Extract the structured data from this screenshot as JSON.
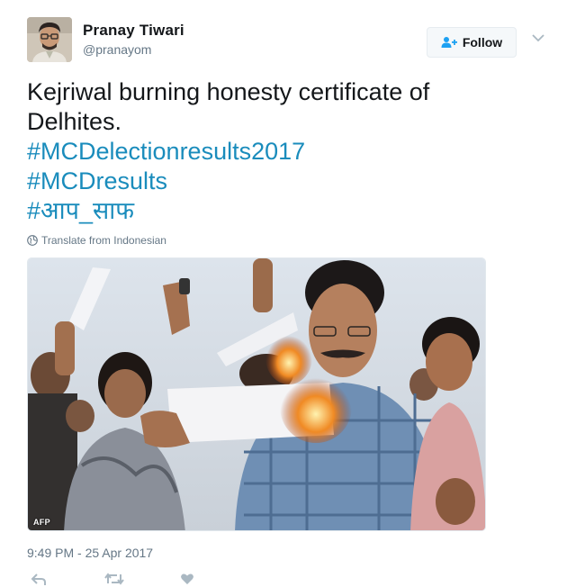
{
  "author": {
    "display_name": "Pranay Tiwari",
    "handle": "@pranayom",
    "avatar_icon": "profile-photo"
  },
  "follow": {
    "label": "Follow",
    "icon": "add-user-icon"
  },
  "menu": {
    "icon": "chevron-down-icon"
  },
  "tweet": {
    "text_lines": [
      "Kejriwal burning honesty certificate of",
      "Delhites."
    ],
    "hashtags": [
      "#MCDelectionresults2017",
      "#MCDresults",
      "#आप_साफ"
    ],
    "translate_label": "Translate from Indonesian",
    "translate_icon": "globe-icon"
  },
  "media": {
    "watermark": "AFP",
    "description_icon": "photo"
  },
  "meta": {
    "timestamp": "9:49 PM - 25 Apr 2017"
  },
  "actions": [
    {
      "name": "reply",
      "icon": "reply-icon"
    },
    {
      "name": "retweet",
      "icon": "retweet-icon"
    },
    {
      "name": "like",
      "icon": "heart-icon"
    }
  ],
  "colors": {
    "link": "#1a8cbc",
    "text": "#14171a",
    "secondary": "#657786",
    "border": "#e6ecf0"
  }
}
